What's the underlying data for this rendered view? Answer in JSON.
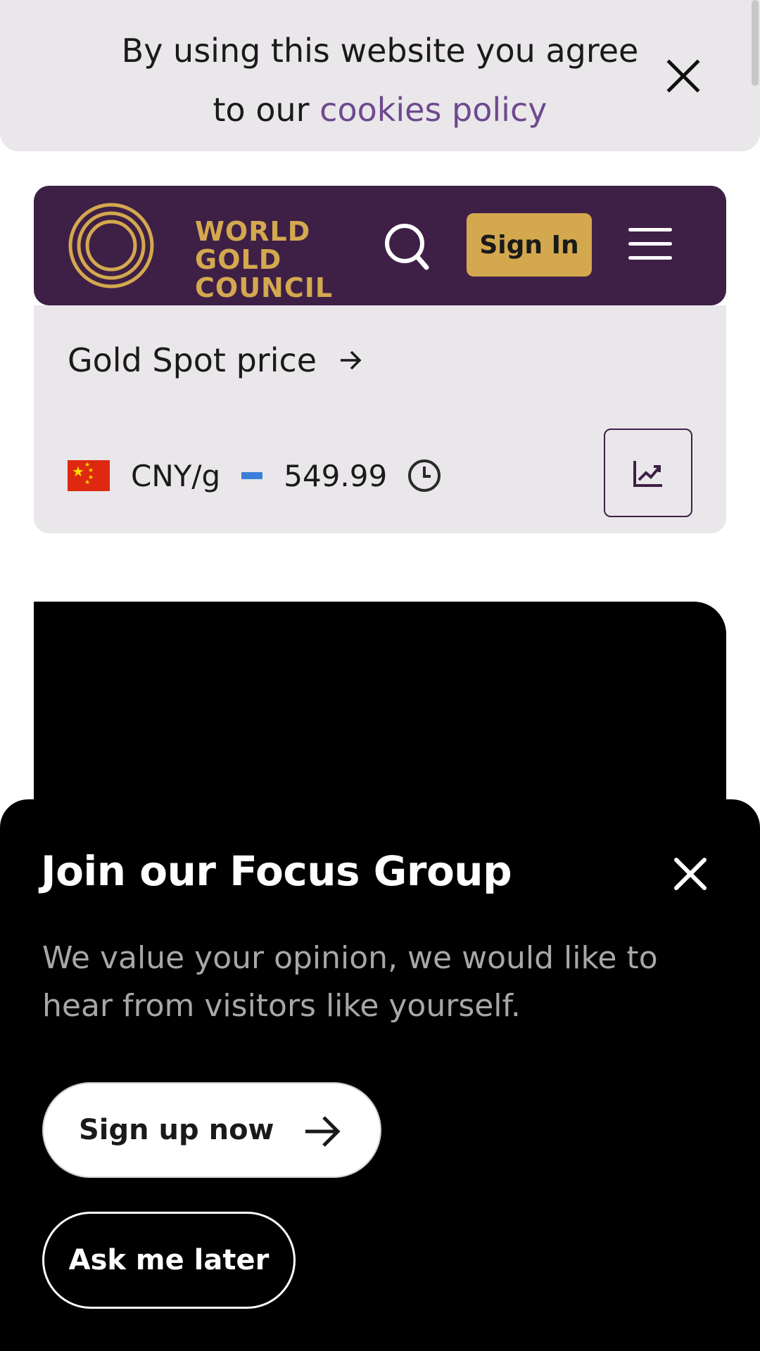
{
  "cookie_banner": {
    "text": "By using this website you agree to our",
    "link_text": "cookies policy",
    "close_icon": "close-icon"
  },
  "header": {
    "logo_lines": [
      "WORLD",
      "GOLD",
      "COUNCIL"
    ],
    "signin_label": "Sign In",
    "search_icon": "search-icon",
    "menu_icon": "hamburger-menu-icon",
    "colors": {
      "background": "#3e2046",
      "gold": "#d4a84e"
    }
  },
  "price_panel": {
    "spot_label": "Gold Spot price",
    "unit": "CNY/g",
    "price": "549.99",
    "flag": "china-flag-icon",
    "change_indicator_color": "#3b7fd9",
    "clock_icon": "clock-icon",
    "chart_icon": "trending-chart-icon"
  },
  "focus_group": {
    "title": "Join our Focus Group",
    "description": "We value your opinion, we would like to hear from visitors like yourself.",
    "signup_label": "Sign up now",
    "later_label": "Ask me later",
    "close_icon": "close-icon"
  }
}
